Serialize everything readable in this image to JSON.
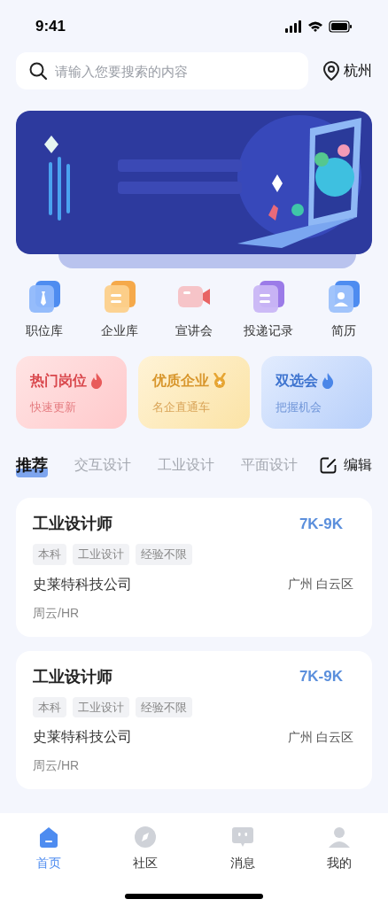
{
  "status_bar": {
    "time": "9:41"
  },
  "search": {
    "placeholder": "请输入您要搜索的内容",
    "city": "杭州"
  },
  "shortcuts": [
    {
      "label": "职位库",
      "kind": "tie"
    },
    {
      "label": "企业库",
      "kind": "building"
    },
    {
      "label": "宣讲会",
      "kind": "video"
    },
    {
      "label": "投递记录",
      "kind": "doc"
    },
    {
      "label": "简历",
      "kind": "person"
    }
  ],
  "promos": [
    {
      "title": "热门岗位",
      "subtitle": "快速更新",
      "kind": "hot"
    },
    {
      "title": "优质企业",
      "subtitle": "名企直通车",
      "kind": "medal"
    },
    {
      "title": "双选会",
      "subtitle": "把握机会",
      "kind": "blue"
    }
  ],
  "tabs": [
    {
      "label": "推荐",
      "selected": true
    },
    {
      "label": "交互设计",
      "selected": false
    },
    {
      "label": "工业设计",
      "selected": false
    },
    {
      "label": "平面设计",
      "selected": false
    }
  ],
  "edit_label": "编辑",
  "jobs": [
    {
      "title": "工业设计师",
      "salary": "7K-9K",
      "tags": [
        "本科",
        "工业设计",
        "经验不限"
      ],
      "company": "史莱特科技公司",
      "location": "广州 白云区",
      "recruiter": "周云/HR"
    },
    {
      "title": "工业设计师",
      "salary": "7K-9K",
      "tags": [
        "本科",
        "工业设计",
        "经验不限"
      ],
      "company": "史莱特科技公司",
      "location": "广州 白云区",
      "recruiter": "周云/HR"
    }
  ],
  "nav": [
    {
      "label": "首页",
      "kind": "home",
      "selected": true
    },
    {
      "label": "社区",
      "kind": "compass",
      "selected": false
    },
    {
      "label": "消息",
      "kind": "chat",
      "selected": false
    },
    {
      "label": "我的",
      "kind": "person",
      "selected": false
    }
  ]
}
